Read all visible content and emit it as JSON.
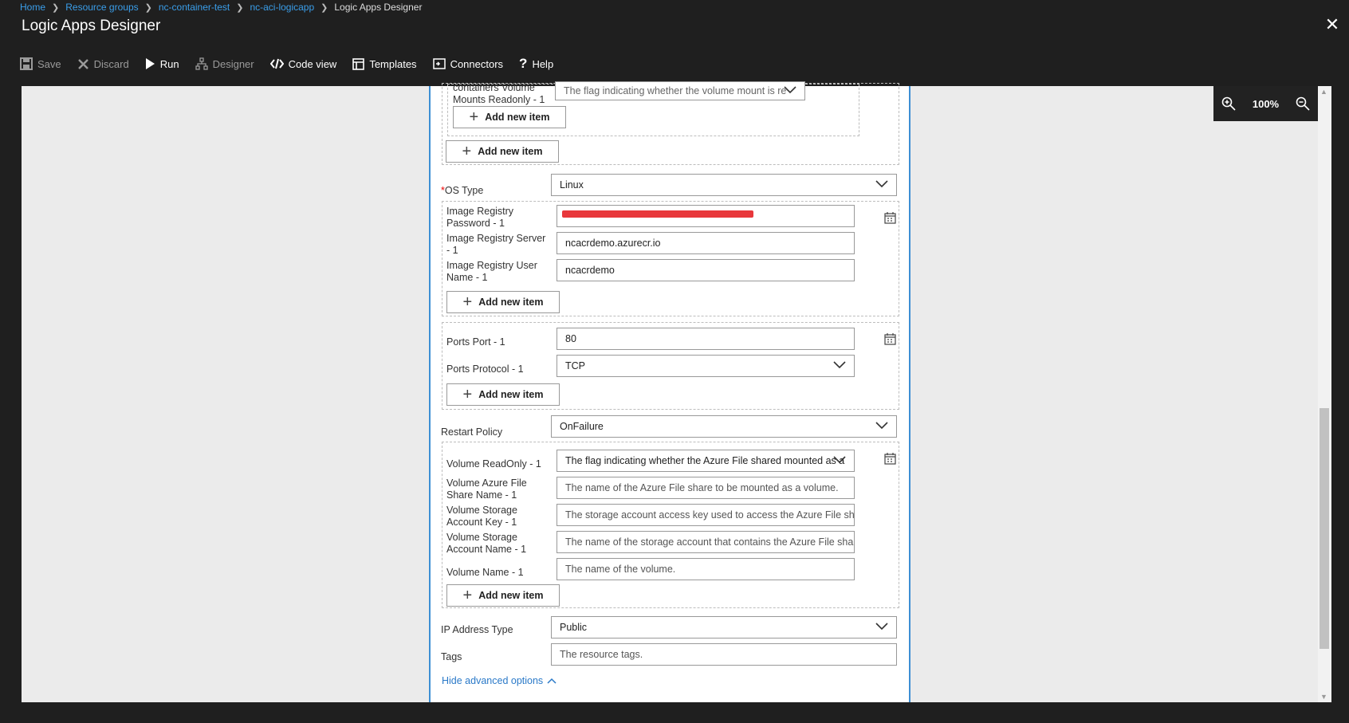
{
  "breadcrumb": {
    "home": "Home",
    "resource_groups": "Resource groups",
    "rg": "nc-container-test",
    "app": "nc-aci-logicapp",
    "current": "Logic Apps Designer"
  },
  "title": "Logic Apps Designer",
  "toolbar": {
    "save": "Save",
    "discard": "Discard",
    "run": "Run",
    "designer": "Designer",
    "code_view": "Code view",
    "templates": "Templates",
    "connectors": "Connectors",
    "help": "Help"
  },
  "zoom": {
    "level": "100%"
  },
  "form": {
    "volume_mounts_readonly": {
      "label_top": "containers Volume",
      "label": "Mounts Readonly - 1",
      "value": "The flag indicating whether the volume mount is re"
    },
    "add_new_item": "Add new item",
    "os_type": {
      "label": "OS Type",
      "value": "Linux"
    },
    "registry": {
      "password_label": "Image Registry Password - 1",
      "server_label": "Image Registry Server - 1",
      "server_value": "ncacrdemo.azurecr.io",
      "user_label": "Image Registry User Name - 1",
      "user_value": "ncacrdemo"
    },
    "ports": {
      "port_label": "Ports Port - 1",
      "port_value": "80",
      "protocol_label": "Ports Protocol - 1",
      "protocol_value": "TCP"
    },
    "restart_policy": {
      "label": "Restart Policy",
      "value": "OnFailure"
    },
    "volume": {
      "readonly_label": "Volume ReadOnly - 1",
      "readonly_value": "The flag indicating whether the Azure File shared mounted as a",
      "share_label": "Volume Azure File Share Name - 1",
      "share_placeholder": "The name of the Azure File share to be mounted as a volume.",
      "key_label": "Volume Storage Account Key - 1",
      "key_placeholder": "The storage account access key used to access the Azure File share",
      "account_label": "Volume Storage Account Name - 1",
      "account_placeholder": "The name of the storage account that contains the Azure File share",
      "name_label": "Volume Name - 1",
      "name_placeholder": "The name of the volume."
    },
    "ip_address_type": {
      "label": "IP Address Type",
      "value": "Public"
    },
    "tags": {
      "label": "Tags",
      "placeholder": "The resource tags."
    },
    "hide_advanced": "Hide advanced options"
  }
}
